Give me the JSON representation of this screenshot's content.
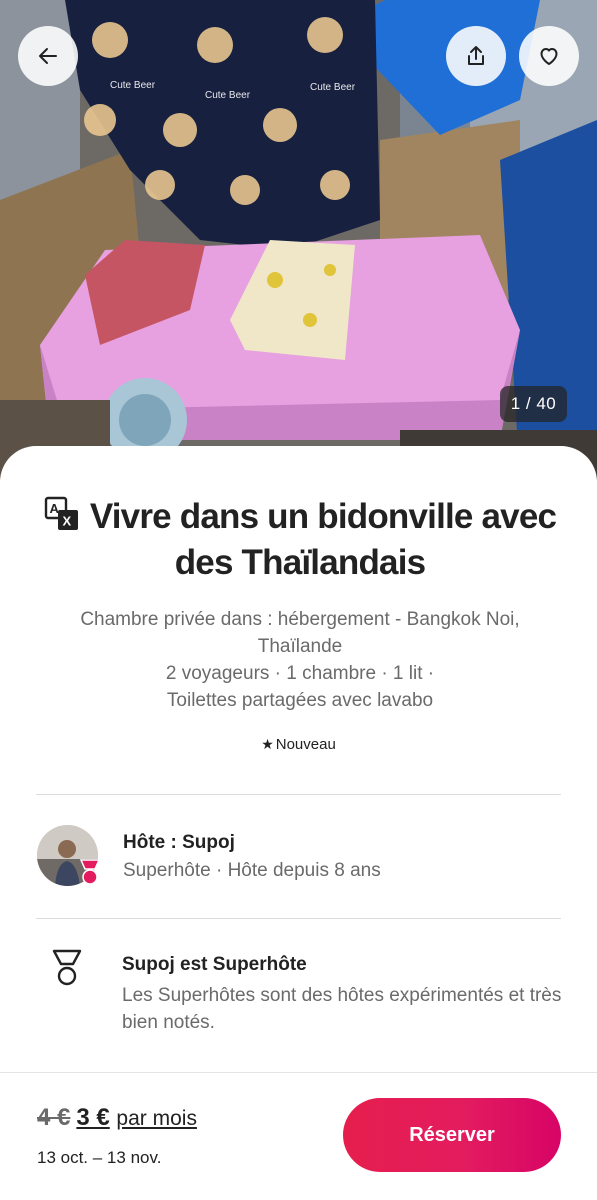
{
  "hero": {
    "photo_counter": "1 / 40",
    "back_icon": "arrow-left-icon",
    "share_icon": "share-icon",
    "favorite_icon": "heart-icon",
    "print_on_fabric": "Cute Beer"
  },
  "listing": {
    "title": "Vivre dans un bidonville avec des Thaïlandais",
    "subtitle": "Chambre privée dans : hébergement - Bangkok Noi, Thaïlande",
    "details_line1": "2 voyageurs · 1 chambre · 1 lit ·",
    "details_line2": "Toilettes partagées avec lavabo",
    "badge": "Nouveau"
  },
  "host": {
    "name": "Hôte : Supoj",
    "subtitle": "Superhôte · Hôte depuis 8 ans"
  },
  "superhost": {
    "title": "Supoj est Superhôte",
    "description": "Les Superhôtes sont des hôtes expérimentés et très bien notés."
  },
  "booking": {
    "old_price": "4 €",
    "new_price": "3 €",
    "period": "par mois",
    "dates": "13 oct. – 13 nov.",
    "reserve_label": "Réserver"
  },
  "colors": {
    "accent": "#E31C5F",
    "text": "#222222",
    "muted": "#6A6A6A"
  }
}
